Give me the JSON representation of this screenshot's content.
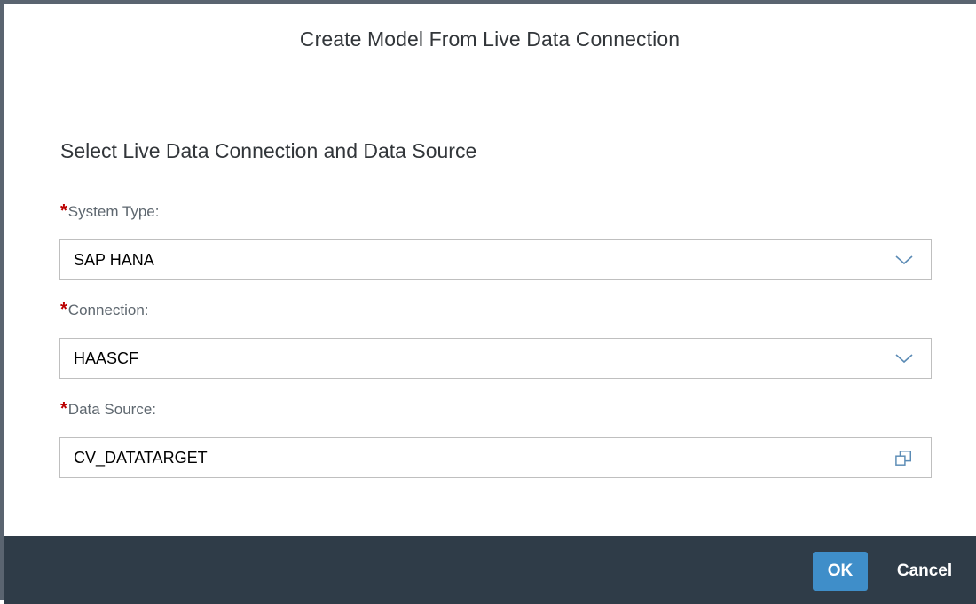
{
  "dialog": {
    "title": "Create Model From Live Data Connection"
  },
  "form": {
    "section_title": "Select Live Data Connection and Data Source",
    "required_marker": "*",
    "fields": [
      {
        "label": "System Type:",
        "value": "SAP HANA",
        "icon": "chevron-down-icon"
      },
      {
        "label": "Connection:",
        "value": "HAASCF",
        "icon": "chevron-down-icon"
      },
      {
        "label": "Data Source:",
        "value": "CV_DATATARGET",
        "icon": "value-help-icon"
      }
    ]
  },
  "footer": {
    "ok_label": "OK",
    "cancel_label": "Cancel"
  },
  "colors": {
    "required": "#bb0000",
    "footer_bg": "#2f3c48",
    "primary_button": "#3f8ec9",
    "icon": "#5b8bb5"
  }
}
